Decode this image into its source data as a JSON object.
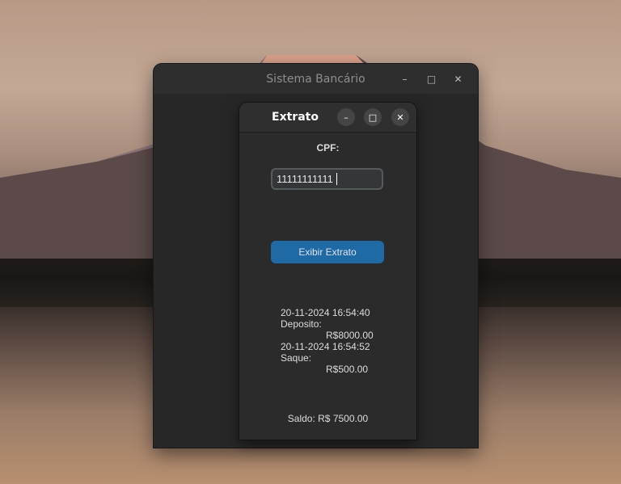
{
  "main_window": {
    "title": "Sistema Bancário",
    "controls": {
      "minimize": "–",
      "maximize": "□",
      "close": "✕"
    }
  },
  "dialog": {
    "title": "Extrato",
    "controls": {
      "minimize": "–",
      "maximize": "□",
      "close": "✕"
    },
    "cpf_label": "CPF:",
    "cpf_value": "11111111111",
    "button_label": "Exibir Extrato",
    "transactions": [
      {
        "datetime": "20-11-2024 16:54:40",
        "type": "Deposito:",
        "amount": "R$8000.00"
      },
      {
        "datetime": "20-11-2024 16:54:52",
        "type": "Saque:",
        "amount": "R$500.00"
      }
    ],
    "balance": "Saldo: R$ 7500.00"
  },
  "colors": {
    "button_accent": "#1f6aa5",
    "window_bg": "#2b2b2b",
    "text": "#dcdcdc"
  }
}
